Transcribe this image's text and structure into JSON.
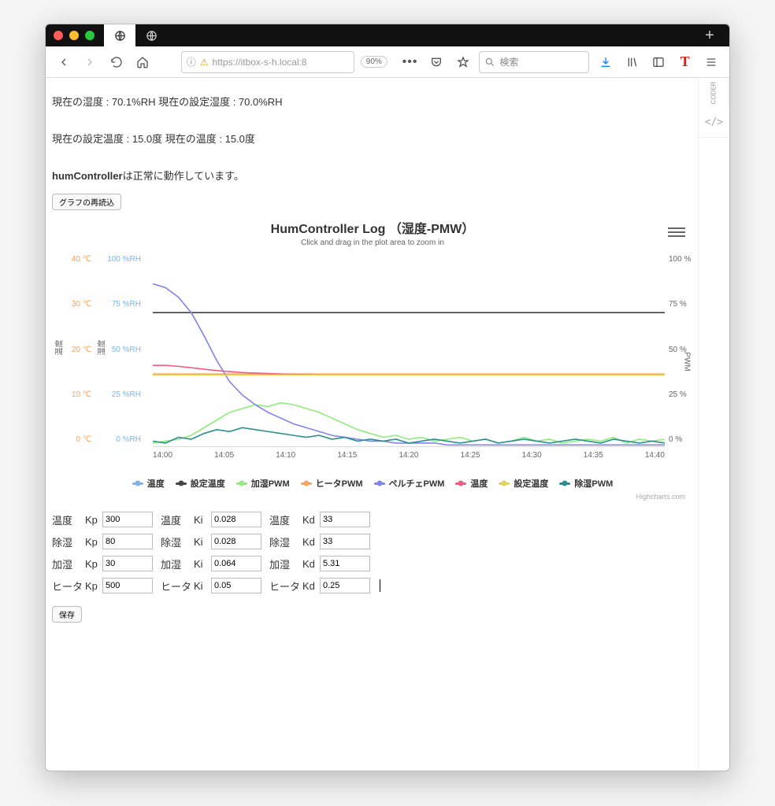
{
  "browser": {
    "url_display": "https://itbox-s-h.local:8",
    "zoom": "90%",
    "search_placeholder": "検索"
  },
  "status": {
    "humidity_line": "現在の湿度 : 70.1%RH   現在の設定湿度 : 70.0%RH",
    "temp_line": "現在の設定温度 : 15.0度 現在の温度 : 15.0度",
    "controller_name": "humController",
    "controller_msg": "は正常に動作しています。"
  },
  "buttons": {
    "reload_graph": "グラフの再読込",
    "save": "保存"
  },
  "chart": {
    "title": "HumController Log （湿度-PMW）",
    "subtitle": "Click and drag in the plot area to zoom in",
    "credit": "Highcharts.com",
    "y_temp_label": "温度",
    "y_rh_label": "湿度",
    "y_pwm_label": "PWM",
    "legend": [
      {
        "name": "温度",
        "color": "#7cb5ec"
      },
      {
        "name": "設定温度",
        "color": "#434348"
      },
      {
        "name": "加湿PWM",
        "color": "#90ed7d"
      },
      {
        "name": "ヒータPWM",
        "color": "#f7a35c"
      },
      {
        "name": "ペルチェPWM",
        "color": "#8085e9"
      },
      {
        "name": "温度",
        "color": "#f15c80"
      },
      {
        "name": "設定温度",
        "color": "#e4d354"
      },
      {
        "name": "除湿PWM",
        "color": "#2b908f"
      }
    ]
  },
  "chart_data": {
    "type": "line",
    "x_ticks": [
      "14:00",
      "14:05",
      "14:10",
      "14:15",
      "14:20",
      "14:25",
      "14:30",
      "14:35",
      "14:40"
    ],
    "y_temp_ticks": [
      "40 ℃",
      "30 ℃",
      "20 ℃",
      "10 ℃",
      "0 ℃"
    ],
    "y_rh_ticks": [
      "100 %RH",
      "75 %RH",
      "50 %RH",
      "25 %RH",
      "0 %RH"
    ],
    "y_pct_ticks": [
      "100 %",
      "75 %",
      "50 %",
      "25 %",
      "0 %"
    ],
    "temp_range": [
      0,
      40
    ],
    "rh_range": [
      0,
      100
    ],
    "pct_range": [
      0,
      100
    ],
    "series": [
      {
        "name": "温度(RH)",
        "color": "#7cb5ec",
        "axis": "rh",
        "values": [
          70,
          70,
          70,
          70,
          70,
          70,
          70,
          70,
          70,
          70,
          70,
          70,
          70,
          70,
          70,
          70,
          70,
          70,
          70,
          70,
          70,
          70,
          70,
          70,
          70,
          70,
          70,
          70,
          70,
          70,
          70,
          70,
          70,
          70,
          70,
          70,
          70,
          70,
          70,
          70,
          70
        ]
      },
      {
        "name": "設定温度(line)",
        "color": "#434348",
        "axis": "rh",
        "values": [
          70,
          70,
          70,
          70,
          70,
          70,
          70,
          70,
          70,
          70,
          70,
          70,
          70,
          70,
          70,
          70,
          70,
          70,
          70,
          70,
          70,
          70,
          70,
          70,
          70,
          70,
          70,
          70,
          70,
          70,
          70,
          70,
          70,
          70,
          70,
          70,
          70,
          70,
          70,
          70,
          70
        ]
      },
      {
        "name": "加湿PWM",
        "color": "#90ed7d",
        "axis": "pct",
        "values": [
          2,
          3,
          4,
          6,
          10,
          14,
          18,
          20,
          22,
          21,
          23,
          22,
          20,
          18,
          15,
          12,
          9,
          7,
          5,
          6,
          4,
          5,
          3,
          4,
          5,
          3,
          4,
          2,
          3,
          5,
          3,
          4,
          2,
          3,
          4,
          3,
          5,
          2,
          4,
          3,
          4
        ]
      },
      {
        "name": "ヒータPWM",
        "color": "#f7a35c",
        "axis": "pct",
        "values": [
          38,
          38,
          38,
          38,
          38,
          38,
          38,
          38,
          38,
          38,
          38,
          38,
          38,
          38,
          38,
          38,
          38,
          38,
          38,
          38,
          38,
          38,
          38,
          38,
          38,
          38,
          38,
          38,
          38,
          38,
          38,
          38,
          38,
          38,
          38,
          38,
          38,
          38,
          38,
          38,
          38
        ]
      },
      {
        "name": "ペルチェPWM",
        "color": "#8085e9",
        "axis": "pct",
        "values": [
          85,
          83,
          78,
          70,
          58,
          45,
          34,
          27,
          22,
          18,
          15,
          12,
          10,
          8,
          6,
          5,
          4,
          3,
          3,
          2,
          2,
          2,
          2,
          1,
          1,
          1,
          1,
          1,
          1,
          1,
          1,
          1,
          1,
          1,
          1,
          1,
          1,
          1,
          1,
          1,
          1
        ]
      },
      {
        "name": "温度",
        "color": "#f15c80",
        "axis": "temp",
        "values": [
          17,
          17,
          16.8,
          16.5,
          16.2,
          15.9,
          15.7,
          15.5,
          15.4,
          15.3,
          15.2,
          15.1,
          15.1,
          15,
          15,
          15,
          15,
          15,
          15,
          15,
          15,
          15,
          15,
          15,
          15,
          15,
          15,
          15,
          15,
          15,
          15,
          15,
          15,
          15,
          15,
          15,
          15,
          15,
          15,
          15,
          15
        ]
      },
      {
        "name": "設定温度",
        "color": "#e4d354",
        "axis": "temp",
        "values": [
          15,
          15,
          15,
          15,
          15,
          15,
          15,
          15,
          15,
          15,
          15,
          15,
          15,
          15,
          15,
          15,
          15,
          15,
          15,
          15,
          15,
          15,
          15,
          15,
          15,
          15,
          15,
          15,
          15,
          15,
          15,
          15,
          15,
          15,
          15,
          15,
          15,
          15,
          15,
          15,
          15
        ]
      },
      {
        "name": "除湿PWM",
        "color": "#2b908f",
        "axis": "pct",
        "values": [
          3,
          2,
          5,
          4,
          7,
          9,
          8,
          10,
          9,
          8,
          7,
          6,
          5,
          6,
          4,
          5,
          3,
          4,
          3,
          4,
          2,
          3,
          4,
          3,
          2,
          3,
          4,
          2,
          3,
          4,
          3,
          2,
          3,
          4,
          3,
          2,
          4,
          3,
          2,
          3,
          2
        ]
      }
    ]
  },
  "params": {
    "rows": [
      {
        "group": "温度",
        "kp": "300",
        "ki": "0.028",
        "kd": "33"
      },
      {
        "group": "除湿",
        "kp": "80",
        "ki": "0.028",
        "kd": "33"
      },
      {
        "group": "加湿",
        "kp": "30",
        "ki": "0.064",
        "kd": "5.31"
      },
      {
        "group": "ヒータ",
        "kp": "500",
        "ki": "0.05",
        "kd": "0.25"
      }
    ],
    "labels": {
      "kp": "Kp",
      "ki": "Ki",
      "kd": "Kd"
    }
  }
}
